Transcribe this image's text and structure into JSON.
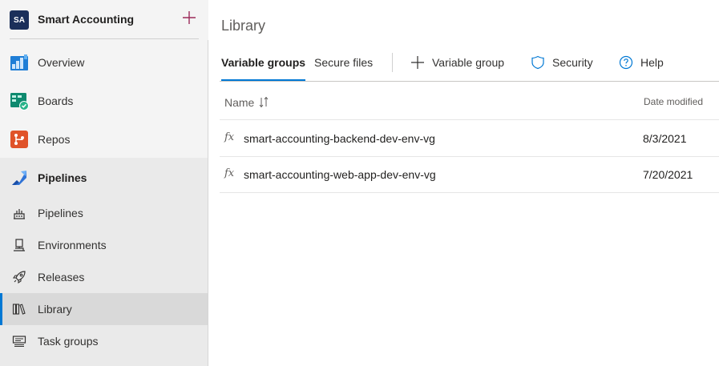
{
  "project": {
    "initials": "SA",
    "name": "Smart Accounting"
  },
  "nav": {
    "overview": "Overview",
    "boards": "Boards",
    "repos": "Repos",
    "pipelines_header": "Pipelines",
    "sub_items": {
      "pipelines": "Pipelines",
      "environments": "Environments",
      "releases": "Releases",
      "library": "Library",
      "task_groups": "Task groups"
    },
    "selected": "Library"
  },
  "page": {
    "title": "Library",
    "tabs": {
      "variable_groups": "Variable groups",
      "secure_files": "Secure files"
    },
    "commands": {
      "add_variable_group": "Variable group",
      "security": "Security",
      "help": "Help"
    }
  },
  "table": {
    "columns": {
      "name": "Name",
      "date_modified": "Date modified"
    },
    "rows": [
      {
        "icon": "fx",
        "name": "smart-accounting-backend-dev-env-vg",
        "date": "8/3/2021"
      },
      {
        "icon": "fx",
        "name": "smart-accounting-web-app-dev-env-vg",
        "date": "7/20/2021"
      }
    ]
  },
  "colors": {
    "accent": "#0078d4",
    "project_avatar": "#1b2f5a",
    "add_button": "#9b2b5a",
    "sidebar_bg": "#eaeaea"
  },
  "icons": {
    "overview": "overview-icon",
    "boards": "boards-icon",
    "repos": "repos-icon",
    "pipelines": "pipelines-icon",
    "environments": "environments-icon",
    "releases": "rocket-icon",
    "library": "library-icon",
    "task_groups": "task-groups-icon"
  }
}
